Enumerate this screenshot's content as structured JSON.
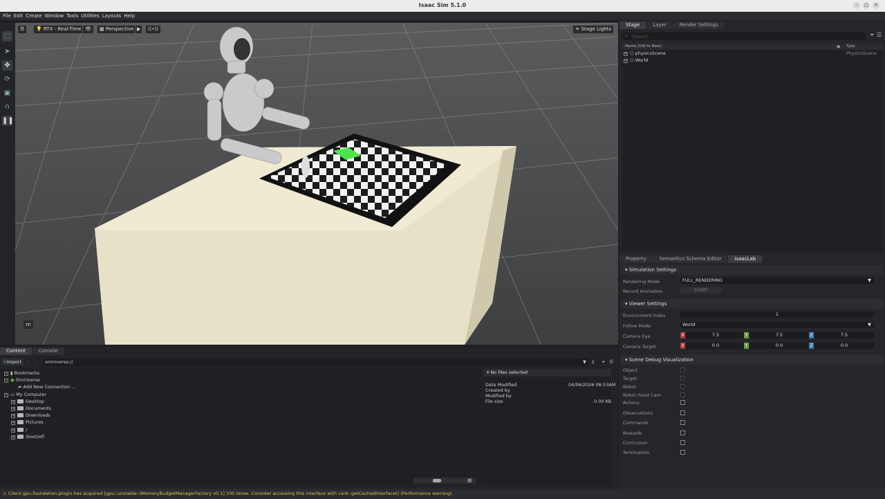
{
  "window": {
    "title": "Isaac Sim 5.1.0"
  },
  "menu": [
    "File",
    "Edit",
    "Create",
    "Window",
    "Tools",
    "Utilities",
    "Layouts",
    "Help"
  ],
  "viewport": {
    "rtx_label": "RTX - Real-Time",
    "camera_label": "Perspective",
    "lights_label": "Stage Lights",
    "axis_label": "m"
  },
  "stage": {
    "tabs": [
      "Stage",
      "Layer",
      "Render Settings"
    ],
    "search_placeholder": "Search",
    "col_name": "Name (Old to New)",
    "col_type": "Type",
    "items": [
      {
        "name": "physicsScene",
        "type": "PhysicsScene"
      },
      {
        "name": "World",
        "type": ""
      }
    ]
  },
  "props": {
    "tabs": [
      "Property",
      "Semantics Schema Editor",
      "IsaacLab"
    ],
    "sim_title": "Simulation Settings",
    "rendering_mode_label": "Rendering Mode",
    "rendering_mode_value": "FULL_RENDERING",
    "record_label": "Record Animation",
    "record_button": "START",
    "viewer_title": "Viewer Settings",
    "env_index_label": "Environment Index",
    "env_index_value": "1",
    "follow_label": "Follow Mode",
    "follow_value": "World",
    "cam_eye_label": "Camera Eye",
    "cam_eye": [
      "7.5",
      "7.5",
      "7.5"
    ],
    "cam_target_label": "Camera Target",
    "cam_target": [
      "0.0",
      "0.0",
      "0.0"
    ],
    "axis": [
      "X",
      "Y",
      "Z"
    ],
    "debug_title": "Scene Debug Visualization",
    "debug_items": [
      "Object",
      "Target",
      "Robot",
      "Robot Head Cam",
      "Actions",
      "Observations",
      "Commands",
      "Rewards",
      "Curriculum",
      "Termination"
    ]
  },
  "content": {
    "tabs": [
      "Content",
      "Console"
    ],
    "import_label": "Import",
    "path": "omniverse://",
    "tree": [
      "Bookmarks",
      "Omniverse",
      "Add New Connection ...",
      "My Computer",
      "Desktop",
      "Documents",
      "Downloads",
      "Pictures",
      "/",
      "/boot/efi"
    ],
    "info_title": "No files selected",
    "date_modified_label": "Date Modified",
    "date_modified": "04/06/2026 08:53AM",
    "created_by_label": "Created by",
    "modified_by_label": "Modified by",
    "file_size_label": "File size",
    "file_size": "0.00 KB"
  },
  "status": {
    "message": "Client gpu.foundation.plugin has acquired [gpu::unstable::IMemoryBudgetManagerFactory v0.1] 100 times. Consider accessing this interface with carb::getCachedInterface() (Performance warning)"
  },
  "colors": {
    "x": "#b03a3a",
    "y": "#6b9a3c",
    "z": "#3a7bb0",
    "accent": "#4de44d"
  }
}
